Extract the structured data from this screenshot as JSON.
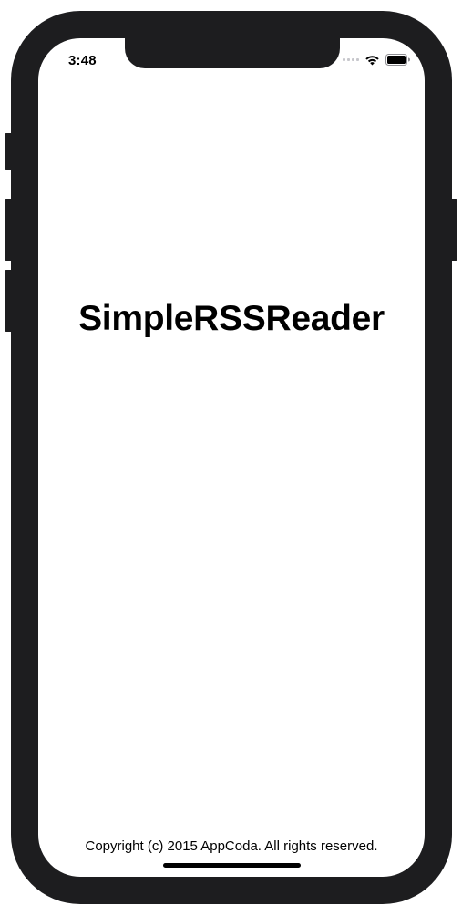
{
  "status_bar": {
    "time": "3:48",
    "signal_icon": "cellular-signal-icon",
    "wifi_icon": "wifi-icon",
    "battery_icon": "battery-icon"
  },
  "app": {
    "title": "SimpleRSSReader",
    "copyright": "Copyright (c) 2015 AppCoda. All rights reserved."
  },
  "colors": {
    "frame": "#1d1d1f",
    "screen_background": "#ffffff",
    "text": "#000000"
  }
}
